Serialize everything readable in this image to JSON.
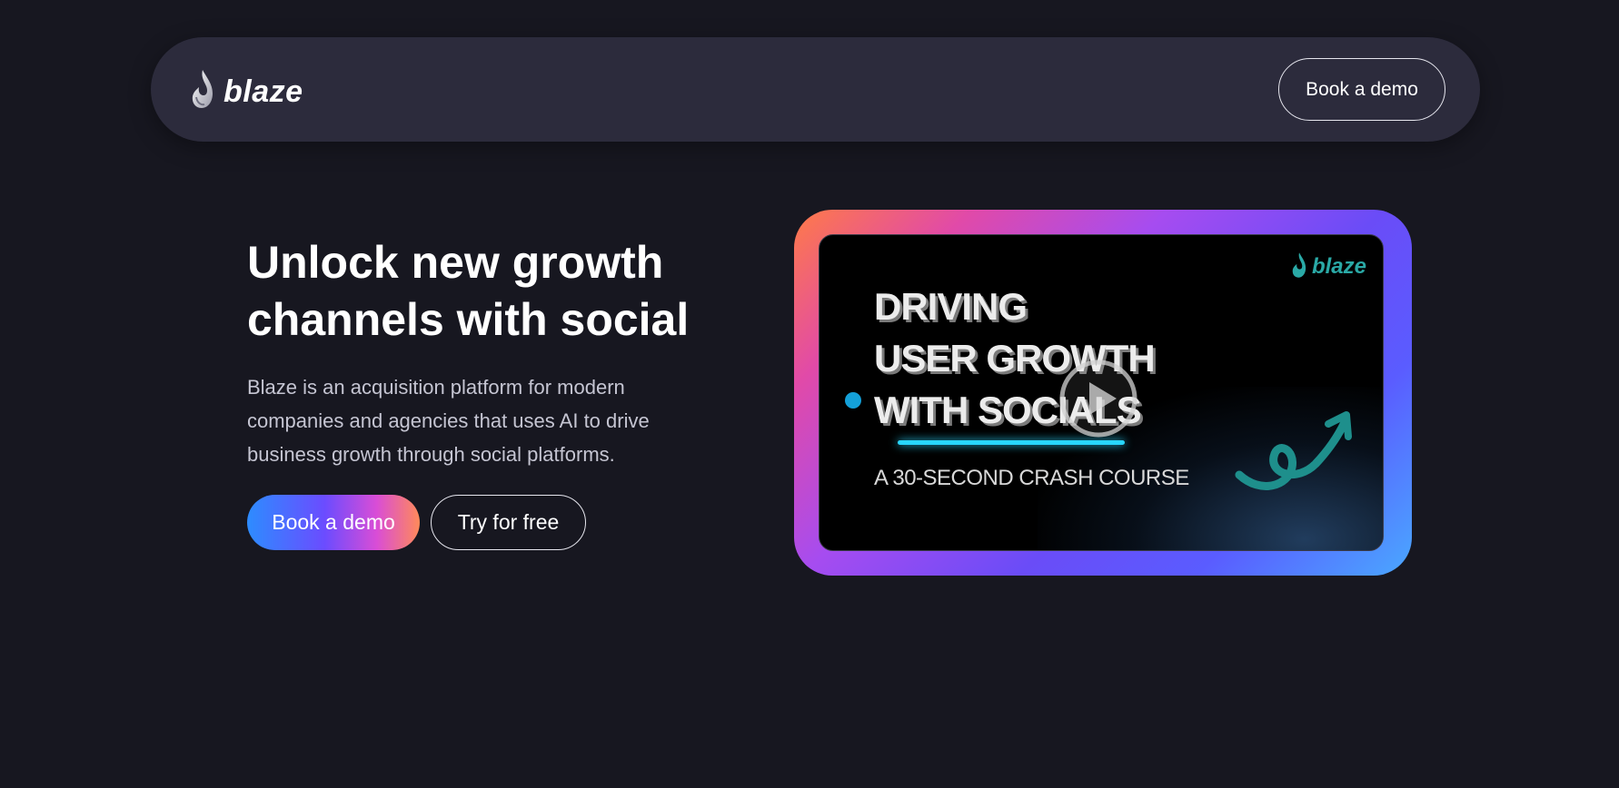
{
  "nav": {
    "logo_text": "blaze",
    "logo_icon": "flame-icon",
    "book_demo_label": "Book a demo"
  },
  "hero": {
    "title_line1": "Unlock new growth",
    "title_line2": "channels with social",
    "description_line1": "Blaze is an acquisition platform for modern",
    "description_line2": "companies and agencies that uses AI to drive",
    "description_line3": "business growth through social platforms.",
    "primary_button": "Book a demo",
    "secondary_button": "Try for free"
  },
  "video": {
    "logo_text": "blaze",
    "headline_line1": "DRIVING",
    "headline_line2": "USER GROWTH",
    "headline_line3": "WITH SOCIALS",
    "subline": "A 30-SECOND CRASH COURSE",
    "play_icon": "play-icon",
    "accent_color": "#28d6ff",
    "logo_color": "#2aa9a6"
  },
  "colors": {
    "background": "#171720",
    "navbar": "#2c2b3c",
    "primary_gradient": [
      "#2d8cff",
      "#6b4cff",
      "#d94dd6",
      "#ff8a5a"
    ],
    "frame_gradient": [
      "#ff7b47",
      "#e14aa8",
      "#a64cf0",
      "#6a4cf7",
      "#4aa8ff"
    ]
  }
}
